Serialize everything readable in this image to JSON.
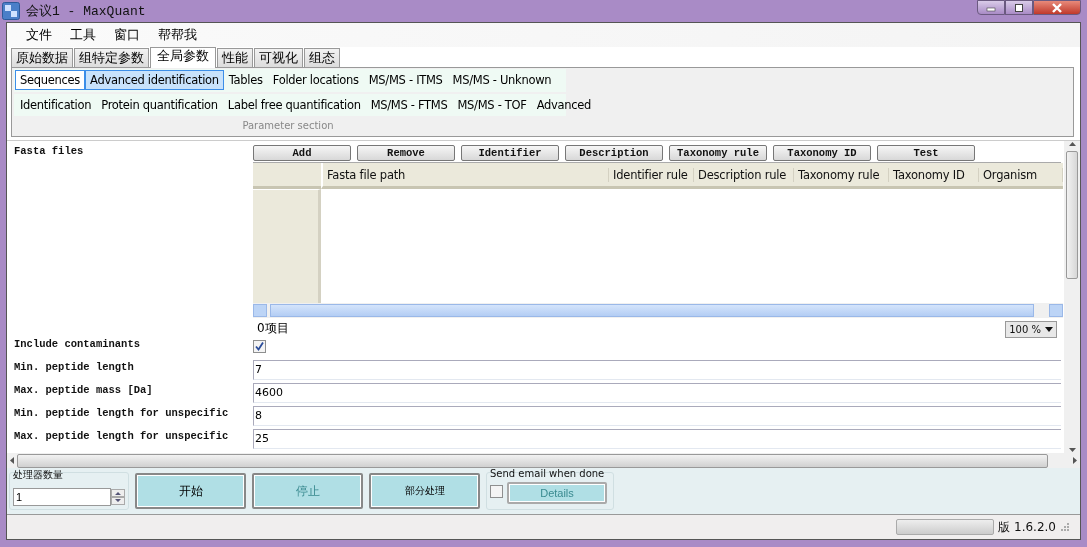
{
  "window": {
    "title": "会议1 - MaxQuant"
  },
  "menu": [
    "文件",
    "工具",
    "窗口",
    "帮帮我"
  ],
  "tabs": [
    {
      "label": "原始数据",
      "selected": false
    },
    {
      "label": "组特定参数",
      "selected": false
    },
    {
      "label": "全局参数",
      "selected": true
    },
    {
      "label": "性能",
      "selected": false
    },
    {
      "label": "可视化",
      "selected": false
    },
    {
      "label": "组态",
      "selected": false
    }
  ],
  "parameter_sections": {
    "front_row": [
      {
        "label": "Sequences",
        "selected": false,
        "focused": true
      },
      {
        "label": "Advanced identification",
        "selected": true,
        "focused": false
      },
      {
        "label": "Tables",
        "selected": false,
        "focused": false
      },
      {
        "label": "Folder locations",
        "selected": false,
        "focused": false
      },
      {
        "label": "MS/MS - ITMS",
        "selected": false,
        "focused": false
      },
      {
        "label": "MS/MS - Unknown",
        "selected": false,
        "focused": false
      }
    ],
    "back_row": [
      {
        "label": "Identification",
        "selected": false,
        "focused": false
      },
      {
        "label": "Protein quantification",
        "selected": false,
        "focused": false
      },
      {
        "label": "Label free quantification",
        "selected": false,
        "focused": false
      },
      {
        "label": "MS/MS - FTMS",
        "selected": false,
        "focused": false
      },
      {
        "label": "MS/MS - TOF",
        "selected": false,
        "focused": false
      },
      {
        "label": "Advanced",
        "selected": false,
        "focused": false
      }
    ],
    "caption": "Parameter section"
  },
  "fasta": {
    "label": "Fasta files",
    "buttons": [
      "Add",
      "Remove",
      "Identifier",
      "Description",
      "Taxonomy rule",
      "Taxonomy ID",
      "Test"
    ],
    "columns": [
      "Fasta file path",
      "Identifier rule",
      "Description rule",
      "Taxonomy rule",
      "Taxonomy ID",
      "Organism"
    ],
    "item_count": "0项目",
    "zoom": "100 %"
  },
  "parameters": [
    {
      "label": "Include contaminants",
      "kind": "checkbox",
      "checked": true
    },
    {
      "label": "Min. peptide length",
      "kind": "field",
      "value": "7"
    },
    {
      "label": "Max. peptide mass [Da]",
      "kind": "field",
      "value": "4600"
    },
    {
      "label": "Min. peptide length for unspecific",
      "kind": "field",
      "value": "8"
    },
    {
      "label": "Max. peptide length for unspecific",
      "kind": "field",
      "value": "25"
    }
  ],
  "processors": {
    "label": "处理器数量",
    "value": "1"
  },
  "actions": [
    {
      "label": "开始",
      "disabled": false
    },
    {
      "label": "停止",
      "disabled": true
    },
    {
      "label": "部分处理",
      "disabled": false
    }
  ],
  "email": {
    "label": "Send email when done",
    "checked": false,
    "button": {
      "label": "Details",
      "disabled": true
    }
  },
  "status_bar": {
    "progress": {
      "level": 0
    },
    "version": "版 1.6.2.0"
  }
}
